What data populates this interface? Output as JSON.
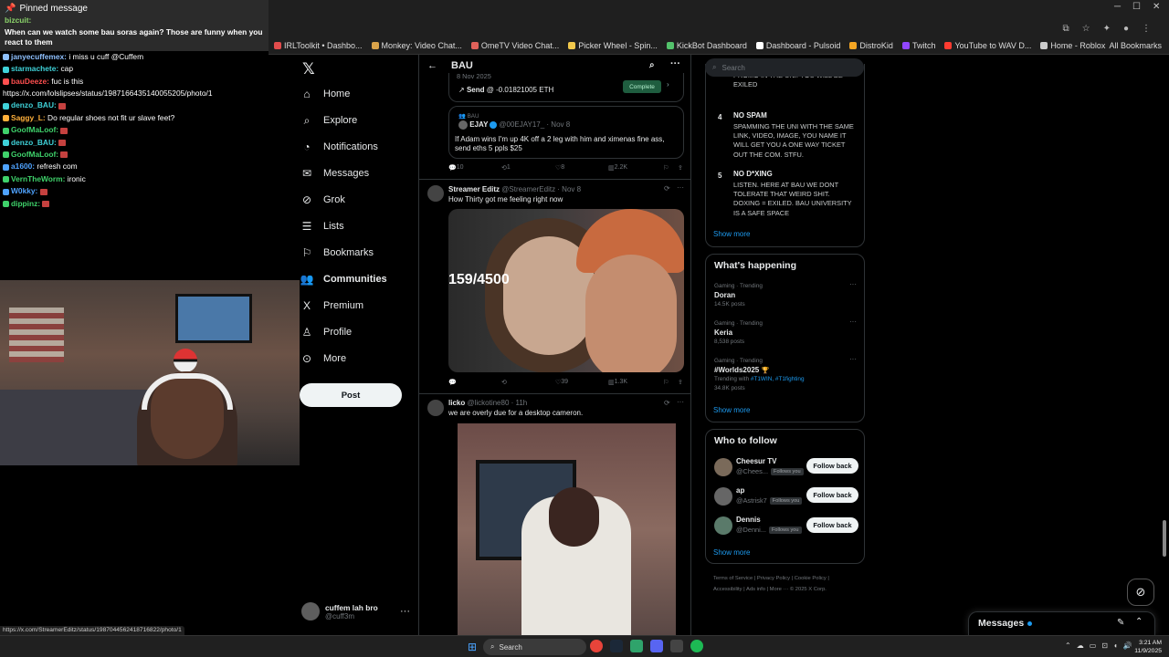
{
  "browser": {
    "bookmarks": [
      {
        "label": "IRLToolkit • Dashbo...",
        "color": "#e24c4c"
      },
      {
        "label": "Monkey: Video Chat...",
        "color": "#d9a34a"
      },
      {
        "label": "OmeTV Video Chat...",
        "color": "#e0615a"
      },
      {
        "label": "Picker Wheel - Spin...",
        "color": "#f2c94c"
      },
      {
        "label": "KickBot Dashboard",
        "color": "#53c26b"
      },
      {
        "label": "Dashboard - Pulsoid",
        "color": "#ffffff"
      },
      {
        "label": "DistroKid",
        "color": "#f5a623"
      },
      {
        "label": "Twitch",
        "color": "#9146ff"
      },
      {
        "label": "YouTube to WAV D...",
        "color": "#ff3b30"
      },
      {
        "label": "Home - Roblox",
        "color": "#cccccc"
      }
    ],
    "all_bookmarks": "All Bookmarks",
    "status_url": "https://x.com/StreamerEditz/status/1987044562418716822/photo/1"
  },
  "chat": {
    "pinned_header": "Pinned message",
    "pinned_user": "bizcuit:",
    "pinned_text": "When can we watch some bau soras again? Those are funny when you react to them",
    "lines": [
      {
        "user": "janyecuffemex:",
        "text": "i miss u cuff @Cuffem",
        "color": "#8fc1ff"
      },
      {
        "user": "starmachete:",
        "text": "cap",
        "color": "#3fd2d9"
      },
      {
        "user": "bauDeeze:",
        "text": "fuc is this",
        "color": "#ff4f4f"
      },
      {
        "user": "",
        "text": "https://x.com/lolslipses/status/1987166435140055205/photo/1",
        "color": "#ffffff"
      },
      {
        "user": "denzo_BAU:",
        "text": "",
        "color": "#3fd2d9"
      },
      {
        "user": "Saggy_L:",
        "text": "Do regular shoes not fit ur slave feet?",
        "color": "#ffb03b"
      },
      {
        "user": "GoofMaLoof:",
        "text": "",
        "color": "#3fd26b"
      },
      {
        "user": "denzo_BAU:",
        "text": "",
        "color": "#3fd2d9"
      },
      {
        "user": "GoofMaLoof:",
        "text": "",
        "color": "#3fd26b"
      },
      {
        "user": "a1600:",
        "text": "refresh com",
        "color": "#4fa3ff"
      },
      {
        "user": "VernTheWorm:",
        "text": "ironic",
        "color": "#3fd26b"
      },
      {
        "user": "W0kky:",
        "text": "",
        "color": "#4fa3ff"
      },
      {
        "user": "dippinz:",
        "text": "",
        "color": "#3fd26b"
      }
    ]
  },
  "nav": {
    "items": [
      {
        "label": "Home",
        "icon": "home-icon",
        "glyph": "⌂"
      },
      {
        "label": "Explore",
        "icon": "search-icon",
        "glyph": "⌕"
      },
      {
        "label": "Notifications",
        "icon": "bell-icon",
        "glyph": "◔"
      },
      {
        "label": "Messages",
        "icon": "mail-icon",
        "glyph": "✉"
      },
      {
        "label": "Grok",
        "icon": "grok-icon",
        "glyph": "⊘"
      },
      {
        "label": "Lists",
        "icon": "lists-icon",
        "glyph": "☰"
      },
      {
        "label": "Bookmarks",
        "icon": "bookmark-icon",
        "glyph": "⚐"
      },
      {
        "label": "Communities",
        "icon": "communities-icon",
        "glyph": "👥"
      },
      {
        "label": "Premium",
        "icon": "x-premium-icon",
        "glyph": "X"
      },
      {
        "label": "Profile",
        "icon": "profile-icon",
        "glyph": "♙"
      },
      {
        "label": "More",
        "icon": "more-circle-icon",
        "glyph": "⊙"
      }
    ],
    "post_label": "Post",
    "account_name": "cuffem lah bro",
    "account_handle": "@cuff3m"
  },
  "feed": {
    "title": "BAU",
    "card": {
      "date": "8 Nov 2025",
      "send_label": "Send",
      "send_value": "@ -0.01821005 ETH",
      "status": "Complete"
    },
    "quote": {
      "community": "BAU",
      "name": "EJAY",
      "handle": "@00EJAY17_ · Nov 8",
      "text": "If Adam wins I'm up 4K off a 2 leg with him and ximenas fine ass, send eths 5 ppls $25"
    },
    "actions1": {
      "replies": "10",
      "reposts": "1",
      "likes": "8",
      "views": "2.2K"
    },
    "tweet2": {
      "name": "Streamer Editz",
      "handle": "@StreamerEditz · Nov 8",
      "text": "How Thirty got me feeling right now",
      "overlay": "159/4500"
    },
    "actions2": {
      "replies": "",
      "reposts": "",
      "likes": "39",
      "views": "1.3K"
    },
    "tweet3": {
      "name": "licko",
      "handle": "@lickotine80 · 11h",
      "text": "we are overly due for a desktop cameron."
    }
  },
  "sidebar": {
    "search_placeholder": "Search",
    "rule3_tail": "PROMO IN THE UNI. YOU WILL BE EXILED",
    "rules": [
      {
        "num": "4",
        "title": "NO SPAM",
        "body": "SPAMMING THE UNI WITH THE SAME LINK, VIDEO, IMAGE, YOU NAME IT WILL GET YOU A ONE WAY TICKET OUT THE COM. STFU."
      },
      {
        "num": "5",
        "title": "NO D*XING",
        "body": "LISTEN. HERE AT BAU WE DONT TOLERATE THAT WEIRD SHIT. DOXING = EXILED. BAU UNIVERSITY IS A SAFE SPACE"
      }
    ],
    "show_more": "Show more",
    "happening_title": "What's happening",
    "trends": [
      {
        "meta": "Gaming · Trending",
        "name": "Doran",
        "posts": "14.5K posts"
      },
      {
        "meta": "Gaming · Trending",
        "name": "Keria",
        "posts": "8,538 posts"
      },
      {
        "meta": "Gaming · Trending",
        "name": "#Worlds2025",
        "posts": "34.8K posts",
        "with_label": "Trending with",
        "with": "#T1WIN, #T1fighting"
      }
    ],
    "follow_title": "Who to follow",
    "follows": [
      {
        "name": "Cheesur TV",
        "handle": "@Chees...",
        "follows_you": "Follows you",
        "button": "Follow back"
      },
      {
        "name": "ap",
        "handle": "@Astrisk7",
        "follows_you": "Follows you",
        "button": "Follow back"
      },
      {
        "name": "Dennis",
        "handle": "@Denni...",
        "follows_you": "Follows you",
        "button": "Follow back"
      }
    ],
    "footer_line1": "Terms of Service  |  Privacy Policy  |  Cookie Policy  |",
    "footer_line2": "Accessibility  |  Ads info  |  More ···  © 2025 X Corp."
  },
  "messages_drawer": {
    "title": "Messages"
  },
  "taskbar": {
    "search": "Search",
    "time": "3:21 AM",
    "date": "11/9/2025"
  }
}
